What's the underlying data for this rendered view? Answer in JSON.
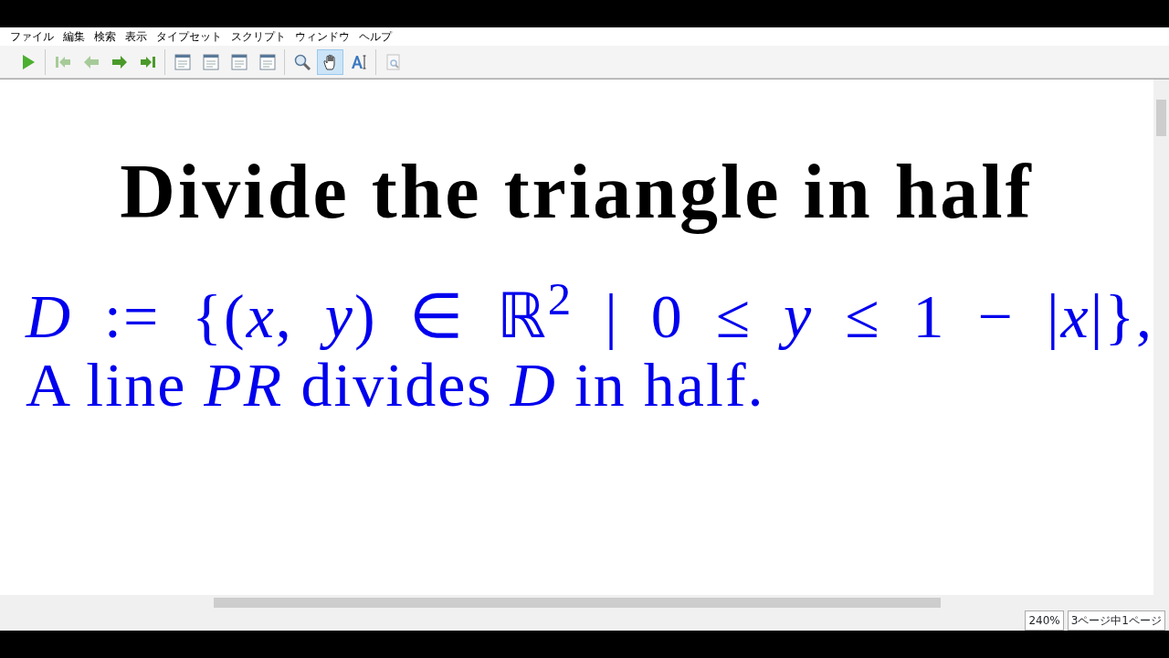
{
  "menu": [
    "ファイル",
    "編集",
    "検索",
    "表示",
    "タイプセット",
    "スクリプト",
    "ウィンドウ",
    "ヘルプ"
  ],
  "toolbar": [
    [
      {
        "kind": "play",
        "selected": false,
        "disabled": false
      }
    ],
    [
      {
        "kind": "first",
        "selected": false,
        "disabled": true
      },
      {
        "kind": "prev",
        "selected": false,
        "disabled": true
      },
      {
        "kind": "next",
        "selected": false,
        "disabled": false
      },
      {
        "kind": "last",
        "selected": false,
        "disabled": false
      }
    ],
    [
      {
        "kind": "page",
        "selected": false,
        "disabled": false
      },
      {
        "kind": "page",
        "selected": false,
        "disabled": false
      },
      {
        "kind": "page",
        "selected": false,
        "disabled": false
      },
      {
        "kind": "page",
        "selected": false,
        "disabled": false
      }
    ],
    [
      {
        "kind": "zoom",
        "selected": false,
        "disabled": false
      },
      {
        "kind": "hand",
        "selected": true,
        "disabled": false
      },
      {
        "kind": "select",
        "selected": false,
        "disabled": false
      }
    ],
    [
      {
        "kind": "preview",
        "selected": false,
        "disabled": true
      }
    ]
  ],
  "document": {
    "title": "Divide the triangle in half",
    "lines": [
      "*D* := {(*x*, *y*) ∈ ℝ$^{2}$ | 0 ≤ *y* ≤ 1 − |*x*|},",
      "A line *PR* divides *D* in half."
    ]
  },
  "status_bar": {
    "zoom": "240%",
    "page": "3ページ中1ページ"
  }
}
